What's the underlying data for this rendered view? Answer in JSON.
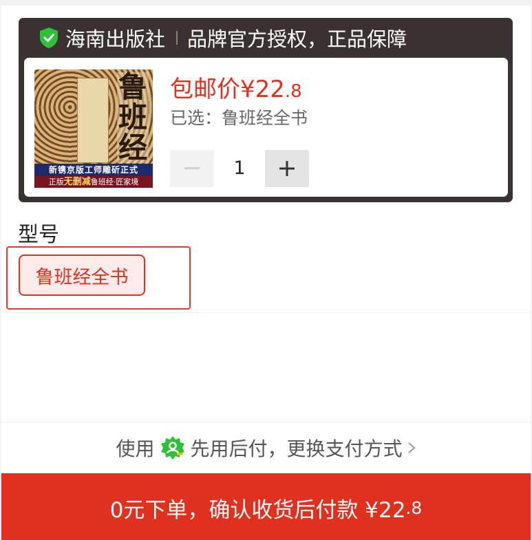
{
  "store": {
    "name": "海南出版社",
    "tagline": "品牌官方授权，正品保障",
    "shield_color": "#2fbf3a"
  },
  "product": {
    "cover": {
      "title": "鲁班经",
      "band1": "新镌京版工师雕斫正式",
      "band2_prefix": "正版",
      "band2_highlight": "无删减",
      "band2_suffix": "鲁班经·匠家境"
    },
    "price_label": "包邮价",
    "price_currency": "¥",
    "price_integer": "22",
    "price_decimal": ".8",
    "selected_label": "已选：",
    "selected_value": "鲁班经全书",
    "quantity": "1"
  },
  "model": {
    "label": "型号",
    "options": [
      {
        "label": "鲁班经全书",
        "selected": true
      }
    ]
  },
  "pay_later": {
    "prefix": "使用",
    "badge_icon": "pay-later-badge-icon",
    "text": "先用后付，更换支付方式"
  },
  "submit": {
    "label": "0元下单，确认收货后付款 ¥22",
    "decimal": ".8"
  },
  "colors": {
    "accent": "#e0301e",
    "store_card_bg": "#3a3230",
    "badge_green": "#2fbf3a"
  }
}
